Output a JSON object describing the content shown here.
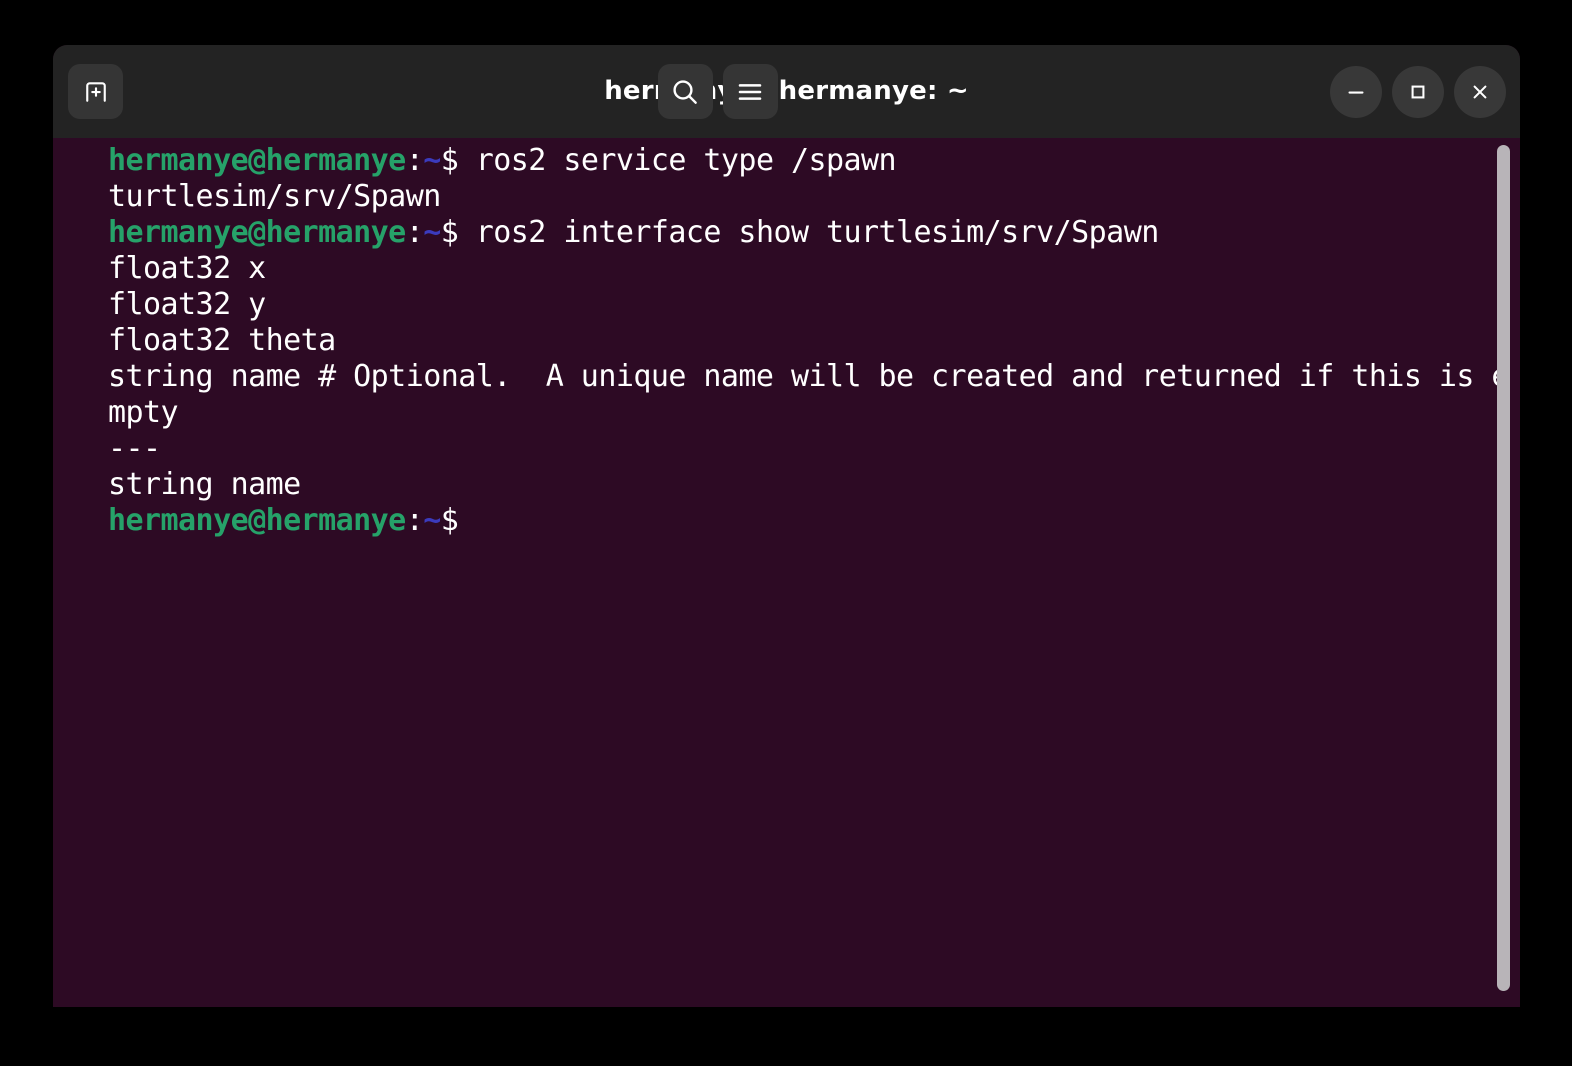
{
  "window": {
    "title": "hermanye@hermanye: ~",
    "bg_color": "#2d0a24",
    "header_color": "#232323",
    "accent_green": "#26a269",
    "accent_blue": "#3b3bbd"
  },
  "headerbar": {
    "new_tab_label": "New Tab",
    "search_label": "Search",
    "menu_label": "Main Menu",
    "minimize_label": "Minimize",
    "maximize_label": "Maximize",
    "close_label": "Close"
  },
  "terminal": {
    "prompt": {
      "user_host": "hermanye@hermanye",
      "colon": ":",
      "path": "~",
      "sigil": "$"
    },
    "lines": [
      {
        "type": "prompt",
        "command": " ros2 service type /spawn"
      },
      {
        "type": "output",
        "text": "turtlesim/srv/Spawn"
      },
      {
        "type": "prompt",
        "command": " ros2 interface show turtlesim/srv/Spawn"
      },
      {
        "type": "output",
        "text": "float32 x"
      },
      {
        "type": "output",
        "text": "float32 y"
      },
      {
        "type": "output",
        "text": "float32 theta"
      },
      {
        "type": "output",
        "text": "string name # Optional.  A unique name will be created and returned if this is e"
      },
      {
        "type": "output",
        "text": "mpty"
      },
      {
        "type": "output",
        "text": "---"
      },
      {
        "type": "output",
        "text": "string name"
      },
      {
        "type": "prompt",
        "command": ""
      }
    ]
  },
  "scrollbar": {
    "thumb_color": "#b8b4b8"
  }
}
